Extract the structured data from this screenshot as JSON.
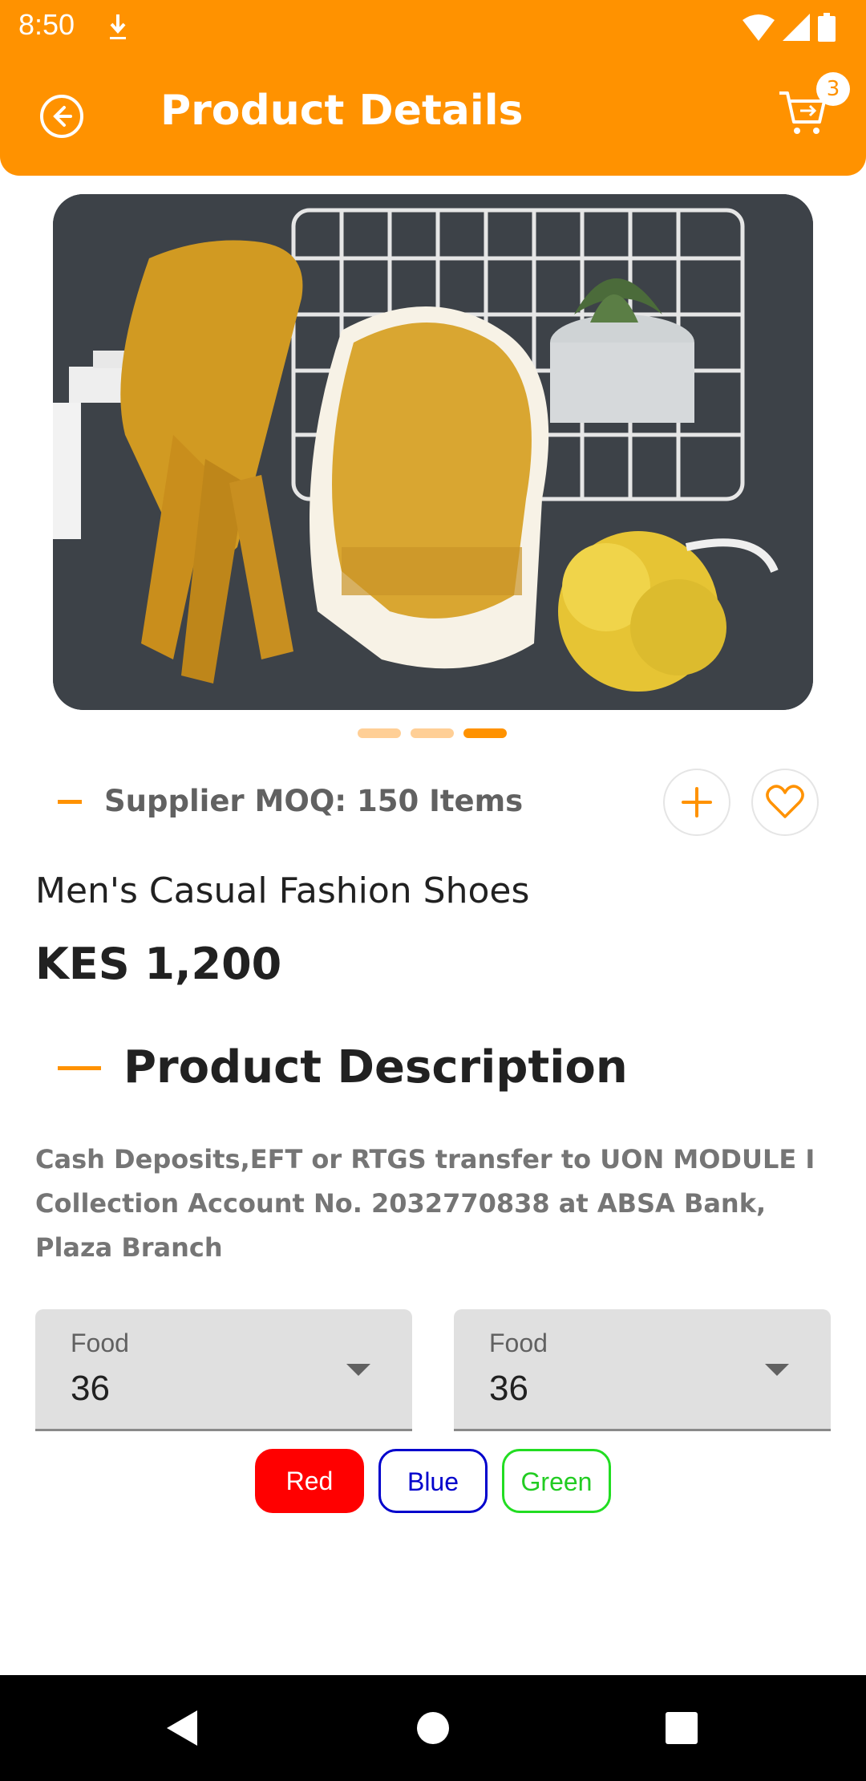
{
  "status_bar": {
    "time": "8:50"
  },
  "app_bar": {
    "title": "Product Details",
    "cart_count": "3"
  },
  "carousel": {
    "page_count": 3,
    "active_page": 3
  },
  "supplier": {
    "moq_text": "Supplier MOQ: 150 Items"
  },
  "product": {
    "name": "Men's Casual Fashion Shoes",
    "price": "KES 1,200"
  },
  "description": {
    "title": "Product Description",
    "text": "Cash Deposits,EFT or RTGS transfer to UON MODULE I Collection Account No. 2032770838 at ABSA Bank, Plaza Branch"
  },
  "dropdowns": [
    {
      "label": "Food",
      "value": "36"
    },
    {
      "label": "Food",
      "value": "36"
    }
  ],
  "color_chips": [
    {
      "label": "Red",
      "color": "#FF0000",
      "selected": true
    },
    {
      "label": "Blue",
      "color": "#0000CC",
      "selected": false
    },
    {
      "label": "Green",
      "color": "#22CC22",
      "selected": false
    }
  ],
  "colors": {
    "accent": "#FF9200",
    "accent_light": "#FFCF96"
  },
  "icons": [
    "download-icon",
    "wifi-icon",
    "signal-icon",
    "battery-icon",
    "back-icon",
    "cart-icon",
    "plus-icon",
    "heart-icon",
    "chevron-down-icon",
    "nav-back-icon",
    "nav-home-icon",
    "nav-recents-icon"
  ]
}
